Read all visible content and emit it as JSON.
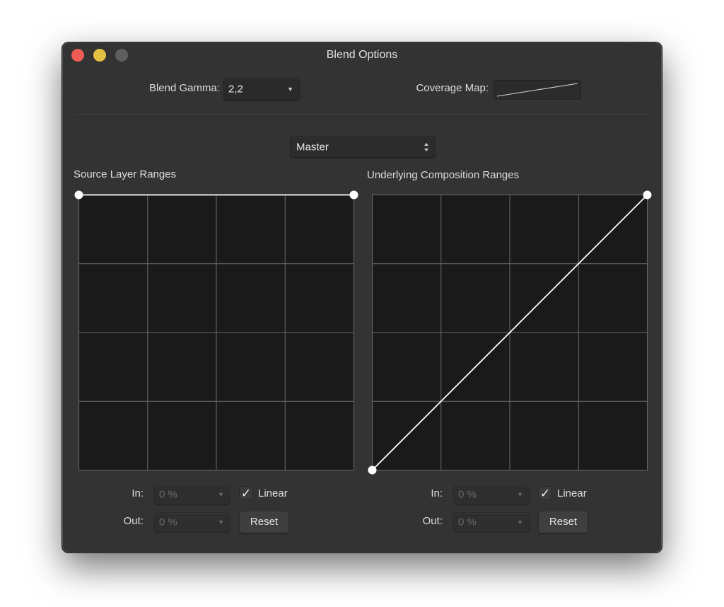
{
  "window": {
    "title": "Blend Options",
    "controls": [
      "close",
      "minimize",
      "maximize"
    ]
  },
  "header": {
    "blend_gamma_label": "Blend Gamma:",
    "blend_gamma_value": "2,2",
    "coverage_map_label": "Coverage Map:"
  },
  "channel": {
    "selected": "Master"
  },
  "source": {
    "title": "Source Layer Ranges",
    "curve_points": [
      [
        0,
        1
      ],
      [
        1,
        1
      ]
    ],
    "in_label": "In:",
    "in_value": "0 %",
    "out_label": "Out:",
    "out_value": "0 %",
    "linear_label": "Linear",
    "linear_checked": true,
    "reset_label": "Reset"
  },
  "underlying": {
    "title": "Underlying Composition Ranges",
    "curve_points": [
      [
        0,
        0
      ],
      [
        1,
        1
      ]
    ],
    "in_label": "In:",
    "in_value": "0 %",
    "out_label": "Out:",
    "out_value": "0 %",
    "linear_label": "Linear",
    "linear_checked": true,
    "reset_label": "Reset"
  },
  "icons": {
    "dropdown_arrow": "▼",
    "checkmark": "✓"
  },
  "colors": {
    "close": "#ee5c53",
    "minimize": "#e3c142",
    "maximize_disabled": "#5e5e5e",
    "window_bg": "#333333",
    "graph_bg": "#1a1a1a",
    "grid_line": "#6a6a6a",
    "curve": "#ffffff"
  }
}
